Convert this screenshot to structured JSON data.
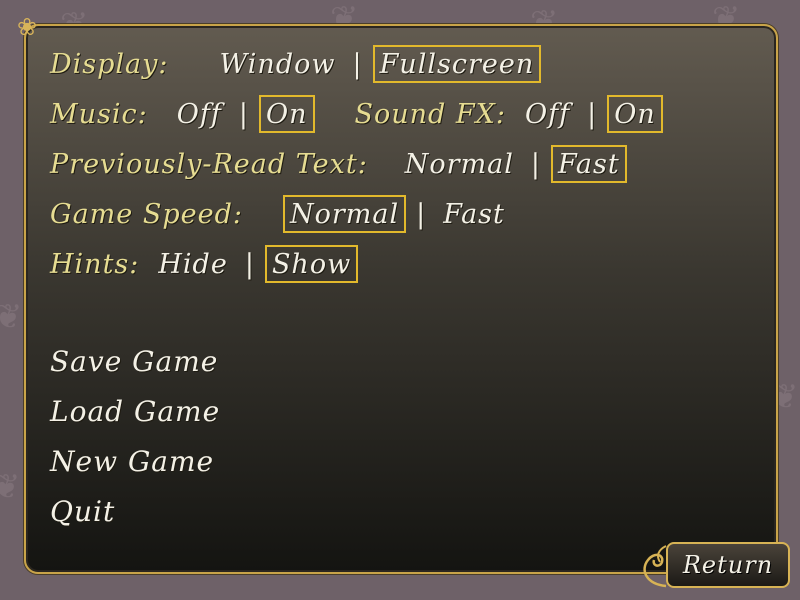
{
  "settings": {
    "display": {
      "label": "Display:",
      "options": [
        "Window",
        "Fullscreen"
      ],
      "selected": "Fullscreen"
    },
    "music": {
      "label": "Music:",
      "options": [
        "Off",
        "On"
      ],
      "selected": "On"
    },
    "sound_fx": {
      "label": "Sound FX:",
      "options": [
        "Off",
        "On"
      ],
      "selected": "On"
    },
    "prev_read_text": {
      "label": "Previously-Read Text:",
      "options": [
        "Normal",
        "Fast"
      ],
      "selected": "Fast"
    },
    "game_speed": {
      "label": "Game Speed:",
      "options": [
        "Normal",
        "Fast"
      ],
      "selected": "Normal"
    },
    "hints": {
      "label": "Hints:",
      "options": [
        "Hide",
        "Show"
      ],
      "selected": "Show"
    },
    "separator": "|"
  },
  "menu": {
    "save": "Save Game",
    "load": "Load Game",
    "new": "New Game",
    "quit": "Quit"
  },
  "return_label": "Return",
  "colors": {
    "label": "#e6dc92",
    "option": "#f4f1e6",
    "selected_border": "#e2b92c",
    "frame": "#c9a449"
  },
  "icons": {
    "background": "butterfly-icon",
    "panel_corner": "flourish-corner-icon",
    "return": "flourish-icon"
  }
}
